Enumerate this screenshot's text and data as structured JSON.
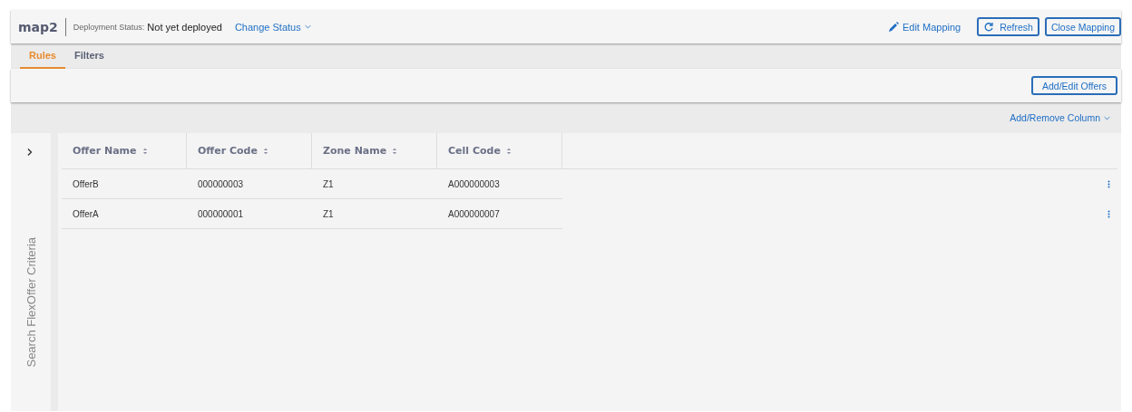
{
  "header": {
    "title": "map2",
    "status_label": "Deployment Status:",
    "status_value": "Not yet deployed",
    "change_status": "Change Status",
    "edit_mapping": "Edit Mapping",
    "refresh": "Refresh",
    "close_mapping": "Close Mapping"
  },
  "tabs": [
    {
      "label": "Rules",
      "selected": true
    },
    {
      "label": "Filters",
      "selected": false
    }
  ],
  "toolbar": {
    "add_edit_offers": "Add/Edit Offers",
    "add_remove_column": "Add/Remove Column"
  },
  "sidebar": {
    "label": "Search FlexOffer Criteria",
    "expanded": false
  },
  "table": {
    "columns": [
      "Offer Name",
      "Offer Code",
      "Zone Name",
      "Cell Code"
    ],
    "rows": [
      [
        "OfferB",
        "000000003",
        "Z1",
        "A000000003"
      ],
      [
        "OfferA",
        "000000001",
        "Z1",
        "A000000007"
      ]
    ]
  }
}
